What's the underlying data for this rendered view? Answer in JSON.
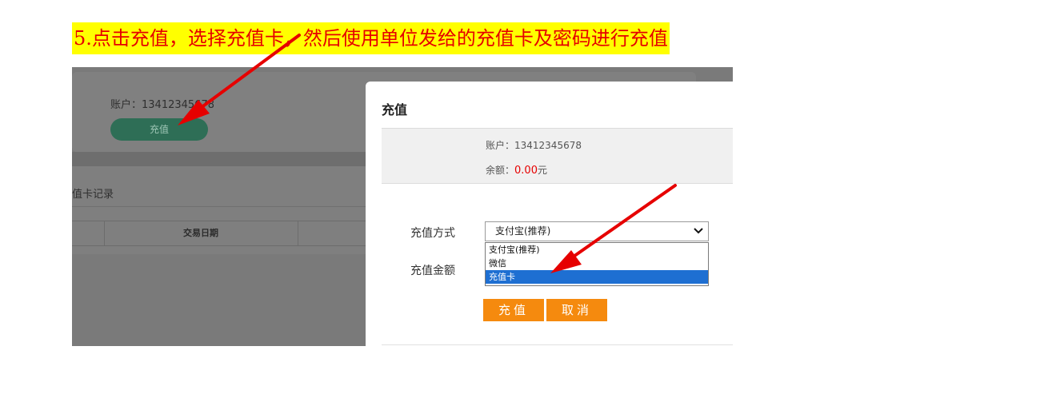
{
  "caption": "5.点击充值，选择充值卡，然后使用单位发给的充值卡及密码进行充值",
  "background_page": {
    "account_text": "账户：13412345678",
    "recharge_button": "充值",
    "records_title": "值卡记录",
    "table_header_date": "交易日期"
  },
  "modal": {
    "title": "充值",
    "account_text": "账户：13412345678",
    "balance_label": "余额：",
    "balance_amount": "0.00",
    "balance_unit": "元",
    "method_label": "充值方式",
    "amount_label": "充值金额",
    "select_value": "支付宝(推荐)",
    "options": [
      "支付宝(推荐)",
      "微信",
      "充值卡"
    ],
    "selected_option_index": 2,
    "confirm_button": "充值",
    "cancel_button": "取消"
  },
  "colors": {
    "caption_background": "#ffff00",
    "caption_text": "#e60000",
    "button_orange": "#f58a0e",
    "option_highlight": "#1e6fd2",
    "arrow_red": "#e60000",
    "balance_red": "#e60000"
  },
  "icons": {
    "select_arrow": "chevron-down-icon",
    "annotation": "red-arrow-icon"
  }
}
